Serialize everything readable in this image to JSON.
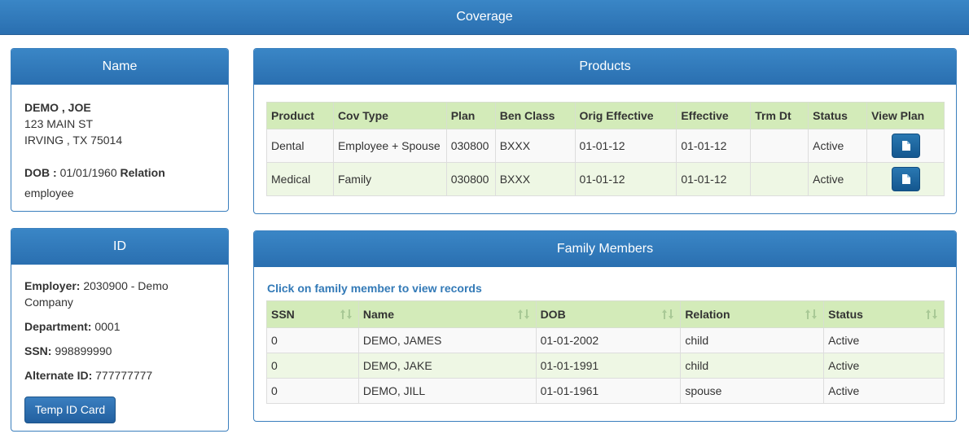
{
  "header": {
    "title": "Coverage"
  },
  "name_panel": {
    "title": "Name",
    "full_name": "DEMO , JOE",
    "address_line1": "123 MAIN ST",
    "address_line2": "IRVING , TX 75014",
    "dob_label": "DOB :",
    "dob_value": "01/01/1960",
    "relation_label": "Relation",
    "relation_value": "employee"
  },
  "id_panel": {
    "title": "ID",
    "employer_label": "Employer:",
    "employer_value": "2030900 - Demo Company",
    "department_label": "Department:",
    "department_value": "0001",
    "ssn_label": "SSN:",
    "ssn_value": "998899990",
    "alt_id_label": "Alternate ID:",
    "alt_id_value": "777777777",
    "temp_id_button": "Temp ID Card"
  },
  "products": {
    "title": "Products",
    "columns": [
      "Product",
      "Cov Type",
      "Plan",
      "Ben Class",
      "Orig Effective",
      "Effective",
      "Trm Dt",
      "Status",
      "View Plan"
    ],
    "rows": [
      {
        "product": "Dental",
        "cov_type": "Employee + Spouse",
        "plan": "030800",
        "ben_class": "BXXX",
        "orig_effective": "01-01-12",
        "effective": "01-01-12",
        "trm_dt": "",
        "status": "Active"
      },
      {
        "product": "Medical",
        "cov_type": "Family",
        "plan": "030800",
        "ben_class": "BXXX",
        "orig_effective": "01-01-12",
        "effective": "01-01-12",
        "trm_dt": "",
        "status": "Active"
      }
    ],
    "view_icon": "file-icon"
  },
  "family": {
    "title": "Family Members",
    "hint": "Click on family member to view records",
    "columns": [
      "SSN",
      "Name",
      "DOB",
      "Relation",
      "Status"
    ],
    "sort_icon": "sort-icon",
    "rows": [
      {
        "ssn": "0",
        "name": "DEMO, JAMES",
        "dob": "01-01-2002",
        "relation": "child",
        "status": "Active"
      },
      {
        "ssn": "0",
        "name": "DEMO, JAKE",
        "dob": "01-01-1991",
        "relation": "child",
        "status": "Active"
      },
      {
        "ssn": "0",
        "name": "DEMO, JILL",
        "dob": "01-01-1961",
        "relation": "spouse",
        "status": "Active"
      }
    ]
  },
  "colors": {
    "header_blue": "#2f78b9",
    "table_header_green": "#d3ebb9",
    "link_blue": "#337ab7"
  }
}
